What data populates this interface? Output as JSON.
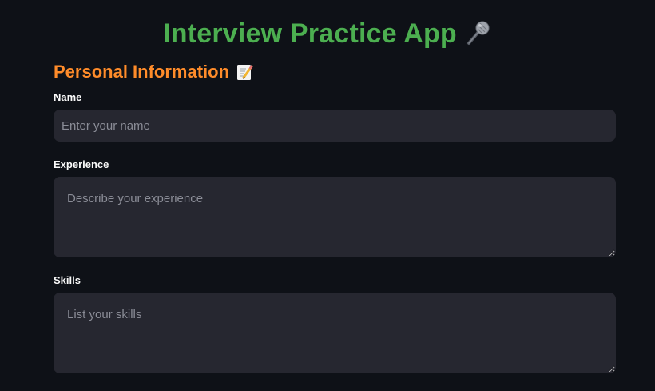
{
  "header": {
    "title": "Interview Practice App",
    "title_icon": "microphone-icon"
  },
  "section": {
    "title": "Personal Information",
    "icon": "memo-icon"
  },
  "form": {
    "name": {
      "label": "Name",
      "placeholder": "Enter your name",
      "value": ""
    },
    "experience": {
      "label": "Experience",
      "placeholder": "Describe your experience",
      "value": ""
    },
    "skills": {
      "label": "Skills",
      "placeholder": "List your skills",
      "value": ""
    }
  },
  "colors": {
    "background": "#0e1117",
    "title": "#4caf50",
    "section_title": "#ff8c2a",
    "input_background": "#262730",
    "placeholder": "#8b8d97",
    "label": "#fafafa"
  }
}
